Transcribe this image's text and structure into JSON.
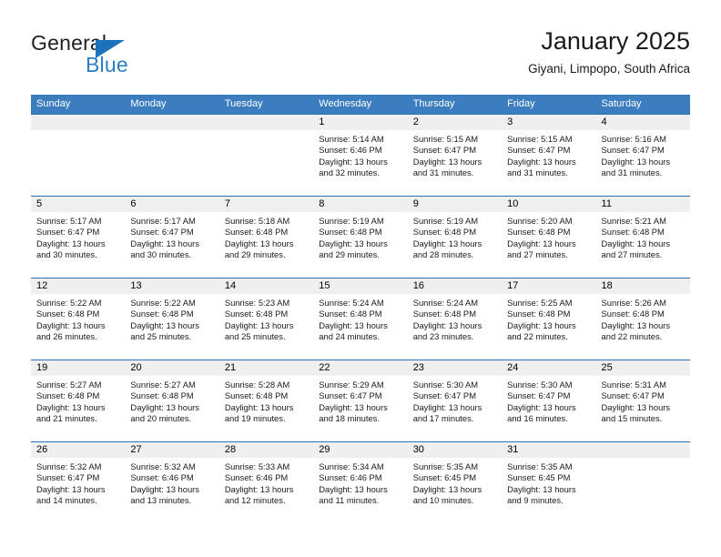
{
  "brand": {
    "name_part1": "General",
    "name_part2": "Blue",
    "accent_color": "#2a7fc4",
    "triangle_color": "#1c72bb"
  },
  "header": {
    "title": "January 2025",
    "subtitle": "Giyani, Limpopo, South Africa"
  },
  "theme": {
    "header_band_color": "#3b7dbf",
    "row_divider_color": "#2f6fae",
    "date_band_color": "#efefef"
  },
  "weekday_headers": [
    "Sunday",
    "Monday",
    "Tuesday",
    "Wednesday",
    "Thursday",
    "Friday",
    "Saturday"
  ],
  "weeks": [
    [
      {
        "day": "",
        "sunrise": "",
        "sunset": "",
        "daylight1": "",
        "daylight2": ""
      },
      {
        "day": "",
        "sunrise": "",
        "sunset": "",
        "daylight1": "",
        "daylight2": ""
      },
      {
        "day": "",
        "sunrise": "",
        "sunset": "",
        "daylight1": "",
        "daylight2": ""
      },
      {
        "day": "1",
        "sunrise": "Sunrise: 5:14 AM",
        "sunset": "Sunset: 6:46 PM",
        "daylight1": "Daylight: 13 hours",
        "daylight2": "and 32 minutes."
      },
      {
        "day": "2",
        "sunrise": "Sunrise: 5:15 AM",
        "sunset": "Sunset: 6:47 PM",
        "daylight1": "Daylight: 13 hours",
        "daylight2": "and 31 minutes."
      },
      {
        "day": "3",
        "sunrise": "Sunrise: 5:15 AM",
        "sunset": "Sunset: 6:47 PM",
        "daylight1": "Daylight: 13 hours",
        "daylight2": "and 31 minutes."
      },
      {
        "day": "4",
        "sunrise": "Sunrise: 5:16 AM",
        "sunset": "Sunset: 6:47 PM",
        "daylight1": "Daylight: 13 hours",
        "daylight2": "and 31 minutes."
      }
    ],
    [
      {
        "day": "5",
        "sunrise": "Sunrise: 5:17 AM",
        "sunset": "Sunset: 6:47 PM",
        "daylight1": "Daylight: 13 hours",
        "daylight2": "and 30 minutes."
      },
      {
        "day": "6",
        "sunrise": "Sunrise: 5:17 AM",
        "sunset": "Sunset: 6:47 PM",
        "daylight1": "Daylight: 13 hours",
        "daylight2": "and 30 minutes."
      },
      {
        "day": "7",
        "sunrise": "Sunrise: 5:18 AM",
        "sunset": "Sunset: 6:48 PM",
        "daylight1": "Daylight: 13 hours",
        "daylight2": "and 29 minutes."
      },
      {
        "day": "8",
        "sunrise": "Sunrise: 5:19 AM",
        "sunset": "Sunset: 6:48 PM",
        "daylight1": "Daylight: 13 hours",
        "daylight2": "and 29 minutes."
      },
      {
        "day": "9",
        "sunrise": "Sunrise: 5:19 AM",
        "sunset": "Sunset: 6:48 PM",
        "daylight1": "Daylight: 13 hours",
        "daylight2": "and 28 minutes."
      },
      {
        "day": "10",
        "sunrise": "Sunrise: 5:20 AM",
        "sunset": "Sunset: 6:48 PM",
        "daylight1": "Daylight: 13 hours",
        "daylight2": "and 27 minutes."
      },
      {
        "day": "11",
        "sunrise": "Sunrise: 5:21 AM",
        "sunset": "Sunset: 6:48 PM",
        "daylight1": "Daylight: 13 hours",
        "daylight2": "and 27 minutes."
      }
    ],
    [
      {
        "day": "12",
        "sunrise": "Sunrise: 5:22 AM",
        "sunset": "Sunset: 6:48 PM",
        "daylight1": "Daylight: 13 hours",
        "daylight2": "and 26 minutes."
      },
      {
        "day": "13",
        "sunrise": "Sunrise: 5:22 AM",
        "sunset": "Sunset: 6:48 PM",
        "daylight1": "Daylight: 13 hours",
        "daylight2": "and 25 minutes."
      },
      {
        "day": "14",
        "sunrise": "Sunrise: 5:23 AM",
        "sunset": "Sunset: 6:48 PM",
        "daylight1": "Daylight: 13 hours",
        "daylight2": "and 25 minutes."
      },
      {
        "day": "15",
        "sunrise": "Sunrise: 5:24 AM",
        "sunset": "Sunset: 6:48 PM",
        "daylight1": "Daylight: 13 hours",
        "daylight2": "and 24 minutes."
      },
      {
        "day": "16",
        "sunrise": "Sunrise: 5:24 AM",
        "sunset": "Sunset: 6:48 PM",
        "daylight1": "Daylight: 13 hours",
        "daylight2": "and 23 minutes."
      },
      {
        "day": "17",
        "sunrise": "Sunrise: 5:25 AM",
        "sunset": "Sunset: 6:48 PM",
        "daylight1": "Daylight: 13 hours",
        "daylight2": "and 22 minutes."
      },
      {
        "day": "18",
        "sunrise": "Sunrise: 5:26 AM",
        "sunset": "Sunset: 6:48 PM",
        "daylight1": "Daylight: 13 hours",
        "daylight2": "and 22 minutes."
      }
    ],
    [
      {
        "day": "19",
        "sunrise": "Sunrise: 5:27 AM",
        "sunset": "Sunset: 6:48 PM",
        "daylight1": "Daylight: 13 hours",
        "daylight2": "and 21 minutes."
      },
      {
        "day": "20",
        "sunrise": "Sunrise: 5:27 AM",
        "sunset": "Sunset: 6:48 PM",
        "daylight1": "Daylight: 13 hours",
        "daylight2": "and 20 minutes."
      },
      {
        "day": "21",
        "sunrise": "Sunrise: 5:28 AM",
        "sunset": "Sunset: 6:48 PM",
        "daylight1": "Daylight: 13 hours",
        "daylight2": "and 19 minutes."
      },
      {
        "day": "22",
        "sunrise": "Sunrise: 5:29 AM",
        "sunset": "Sunset: 6:47 PM",
        "daylight1": "Daylight: 13 hours",
        "daylight2": "and 18 minutes."
      },
      {
        "day": "23",
        "sunrise": "Sunrise: 5:30 AM",
        "sunset": "Sunset: 6:47 PM",
        "daylight1": "Daylight: 13 hours",
        "daylight2": "and 17 minutes."
      },
      {
        "day": "24",
        "sunrise": "Sunrise: 5:30 AM",
        "sunset": "Sunset: 6:47 PM",
        "daylight1": "Daylight: 13 hours",
        "daylight2": "and 16 minutes."
      },
      {
        "day": "25",
        "sunrise": "Sunrise: 5:31 AM",
        "sunset": "Sunset: 6:47 PM",
        "daylight1": "Daylight: 13 hours",
        "daylight2": "and 15 minutes."
      }
    ],
    [
      {
        "day": "26",
        "sunrise": "Sunrise: 5:32 AM",
        "sunset": "Sunset: 6:47 PM",
        "daylight1": "Daylight: 13 hours",
        "daylight2": "and 14 minutes."
      },
      {
        "day": "27",
        "sunrise": "Sunrise: 5:32 AM",
        "sunset": "Sunset: 6:46 PM",
        "daylight1": "Daylight: 13 hours",
        "daylight2": "and 13 minutes."
      },
      {
        "day": "28",
        "sunrise": "Sunrise: 5:33 AM",
        "sunset": "Sunset: 6:46 PM",
        "daylight1": "Daylight: 13 hours",
        "daylight2": "and 12 minutes."
      },
      {
        "day": "29",
        "sunrise": "Sunrise: 5:34 AM",
        "sunset": "Sunset: 6:46 PM",
        "daylight1": "Daylight: 13 hours",
        "daylight2": "and 11 minutes."
      },
      {
        "day": "30",
        "sunrise": "Sunrise: 5:35 AM",
        "sunset": "Sunset: 6:45 PM",
        "daylight1": "Daylight: 13 hours",
        "daylight2": "and 10 minutes."
      },
      {
        "day": "31",
        "sunrise": "Sunrise: 5:35 AM",
        "sunset": "Sunset: 6:45 PM",
        "daylight1": "Daylight: 13 hours",
        "daylight2": "and 9 minutes."
      },
      {
        "day": "",
        "sunrise": "",
        "sunset": "",
        "daylight1": "",
        "daylight2": ""
      }
    ]
  ]
}
